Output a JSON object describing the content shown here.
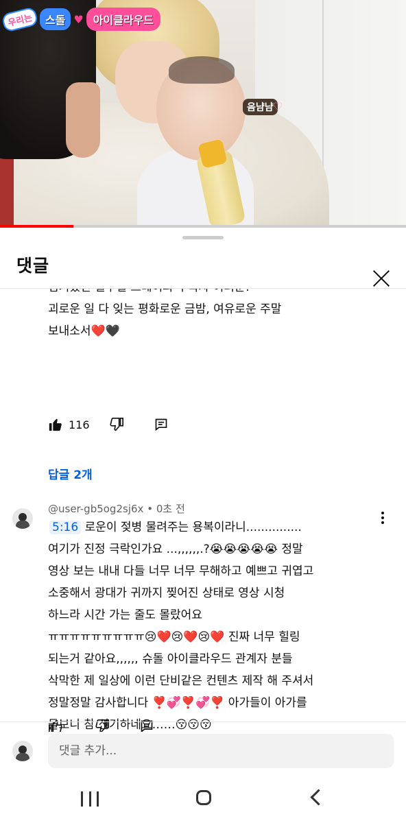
{
  "video": {
    "badge_small": "우리는",
    "badge_main": "스돌",
    "badge_heart": "♥",
    "badge_title": "아이클라우드",
    "side_caption": "음냠냠",
    "side_heart": "♡",
    "progress_fraction": 0.18,
    "colors": {
      "progress": "#ff0000",
      "badge_title_bg": "#ff4f9a",
      "badge_main_bg": "#3a86ff"
    }
  },
  "sheet": {
    "title": "댓글",
    "close_icon": "close-icon"
  },
  "comment1": {
    "lines": [
      "힘겨웠던 일주일 스테이와 구독자 여러분!",
      "괴로운 일 다 잊는 평화로운 금밤, 여유로운 주말",
      "보내소서❤️🖤"
    ],
    "likes": "116",
    "replies_label": "답글 2개"
  },
  "comment2": {
    "author": "@user-gb5og2sj6x",
    "time": "0초 전",
    "separator": "•",
    "timestamp": "5:16",
    "first_line_rest": " 로운이 젖병 물려주는 용복이라니...............",
    "lines": [
      "여기가 진정 극락인가요 ...,,,,,,.?😭😭😭😭😭 정말",
      "영상 보는 내내 다들 너무 너무 무해하고 예쁘고 귀엽고",
      "소중해서 광대가 귀까지 찢어진 상태로 영상 시청",
      "하느라 시간 가는 줄도 몰랐어요",
      "ㅠㅠㅠㅠㅠㅠㅠㅠㅠ😢❤️😢❤️😢❤️ 진짜 너무 힐링",
      "되는거 같아요,,,,,, 슈돌 아이클라우드 관계자 분들",
      "삭막한 제 일상에 이런 단비같은 컨텐츠 제작 해 주셔서",
      "정말정말 감사합니다 ❣️💞❣️💞❣️ 아가들이 아가를",
      "돌보니 참 신기하네요……😚😚😚"
    ]
  },
  "input": {
    "placeholder": "댓글 추가..."
  },
  "nav": {
    "recent": "recent-apps-icon",
    "home": "home-icon",
    "back": "back-icon"
  }
}
